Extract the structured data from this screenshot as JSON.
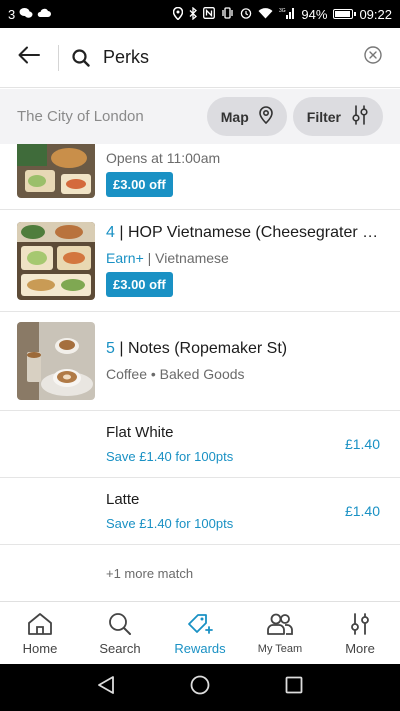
{
  "status_bar": {
    "notification_count": "3",
    "battery": "94%",
    "battery_level": 0.94,
    "time": "09:22",
    "network": "3G"
  },
  "search": {
    "query": "Perks"
  },
  "filters": {
    "location": "The City of London",
    "map_label": "Map",
    "filter_label": "Filter"
  },
  "results": [
    {
      "detail": "Opens at 11:00am",
      "badge": "£3.00 off"
    },
    {
      "number": "4",
      "name": " | HOP Vietnamese (Cheesegrater - L…",
      "tag": "Earn+",
      "category": " | Vietnamese",
      "badge": "£3.00 off"
    },
    {
      "number": "5",
      "name": " | Notes (Ropemaker St)",
      "category": "Coffee • Baked Goods",
      "products": [
        {
          "name": "Flat White",
          "saving": "Save £1.40 for 100pts",
          "price": "£1.40"
        },
        {
          "name": "Latte",
          "saving": "Save £1.40 for 100pts",
          "price": "£1.40"
        }
      ],
      "more_matches": "+1 more match"
    }
  ],
  "tabs": [
    {
      "label": "Home",
      "icon": "home-icon"
    },
    {
      "label": "Search",
      "icon": "search-icon"
    },
    {
      "label": "Rewards",
      "icon": "rewards-icon",
      "active": true
    },
    {
      "label": "My Team",
      "icon": "team-icon"
    },
    {
      "label": "More",
      "icon": "sliders-icon"
    }
  ],
  "colors": {
    "accent": "#1a91c4",
    "pill_bg": "#dcdce0",
    "filter_row_bg": "#f3f3f5"
  }
}
